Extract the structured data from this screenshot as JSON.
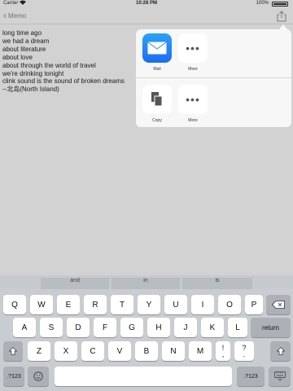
{
  "status_bar": {
    "carrier": "Carrier",
    "wifi": "wifi-icon",
    "time": "10:28 PM",
    "battery_pct": "100%"
  },
  "nav": {
    "back_label": "Memo"
  },
  "memo_lines": [
    "long time ago",
    "we had a dream",
    "about literature",
    "about love",
    "about through the world of travel",
    "we're drinking tonight",
    "clink sound is the sound of broken dreams",
    "--北岛(North Island)"
  ],
  "share_sheet": {
    "row1": [
      {
        "label": "Mail",
        "icon": "mail-icon"
      },
      {
        "label": "More",
        "icon": "more-icon"
      }
    ],
    "row2": [
      {
        "label": "Copy",
        "icon": "copy-icon"
      },
      {
        "label": "More",
        "icon": "more-icon"
      }
    ]
  },
  "keyboard": {
    "suggestions": [
      "and",
      "in",
      "is"
    ],
    "row1": [
      "Q",
      "W",
      "E",
      "R",
      "T",
      "Y",
      "U",
      "I",
      "O",
      "P"
    ],
    "row2": [
      "A",
      "S",
      "D",
      "F",
      "G",
      "H",
      "J",
      "K",
      "L"
    ],
    "row2_action": "return",
    "row3": [
      "Z",
      "X",
      "C",
      "V",
      "B",
      "N",
      "M"
    ],
    "row3_punct1": [
      "!",
      ","
    ],
    "row3_punct2": [
      "?",
      "."
    ],
    "row4_left": ".?123",
    "row4_right": ".?123"
  }
}
